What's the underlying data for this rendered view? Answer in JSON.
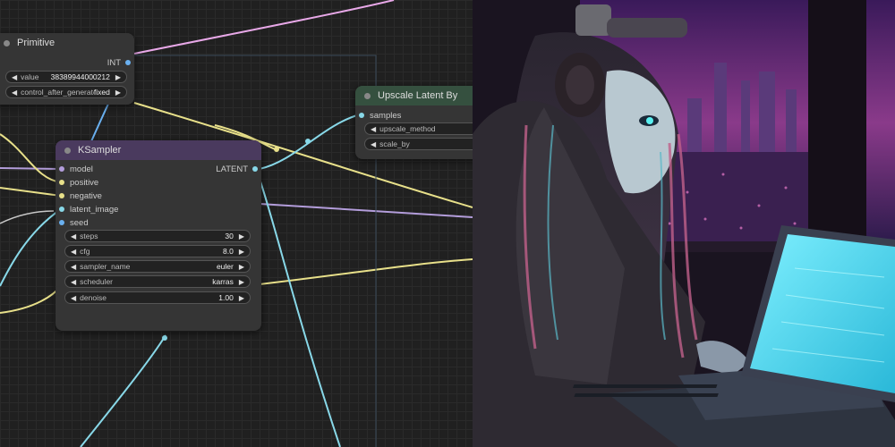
{
  "nodes": {
    "primitive": {
      "title": "Primitive",
      "output_label": "INT",
      "widgets": [
        {
          "label": "value",
          "value": "383899440002​12"
        },
        {
          "label": "control_after_generate",
          "value": "fixed"
        }
      ]
    },
    "ksampler": {
      "title": "KSampler",
      "inputs": [
        "model",
        "positive",
        "negative",
        "latent_image",
        "seed"
      ],
      "output_label": "LATENT",
      "widgets": [
        {
          "label": "steps",
          "value": "30"
        },
        {
          "label": "cfg",
          "value": "8.0"
        },
        {
          "label": "sampler_name",
          "value": "euler"
        },
        {
          "label": "scheduler",
          "value": "karras"
        },
        {
          "label": "denoise",
          "value": "1.00"
        }
      ]
    },
    "upscale": {
      "title": "Upscale Latent By",
      "inputs": [
        "samples"
      ],
      "widgets": [
        {
          "label": "upscale_method",
          "value": ""
        },
        {
          "label": "scale_by",
          "value": ""
        }
      ]
    }
  },
  "colors": {
    "ksampler_header": "#4a3a5e",
    "upscale_header": "#35503f",
    "wire_model": "#b39ddb",
    "wire_conditioning": "#e8e08a",
    "wire_latent": "#88d8e8",
    "wire_int": "#6ab0f0",
    "wire_pink": "#e8a8e8"
  },
  "illustration": {
    "description_icon": "anime-girl-laptop-image"
  }
}
